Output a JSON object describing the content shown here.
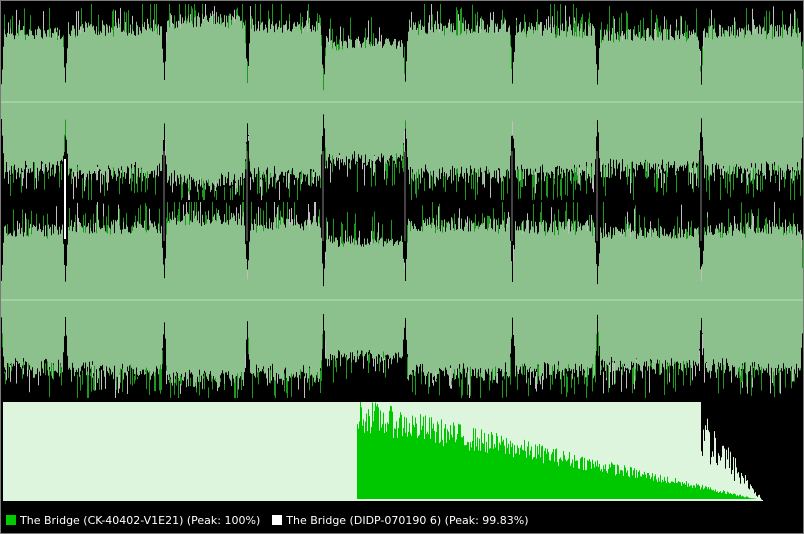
{
  "colors": {
    "background": "#000000",
    "track_a": "#00cc00",
    "track_b": "#ffffff",
    "waveform_fill": "#8cc08c",
    "waveform_spike_a": "#1e9a1e",
    "waveform_spike_b": "#c0c0c0",
    "centerline": "#b8e0b8",
    "spectrum_base": "#dcf5dc",
    "spectrum_peak": "#00c800"
  },
  "legend": {
    "items": [
      {
        "color": "#00cc00",
        "label": "The Bridge (CK-40402-V1E21) (Peak: 100%)"
      },
      {
        "color": "#ffffff",
        "label": "The Bridge (DIDP-070190 6) (Peak: 99.83%)"
      }
    ]
  },
  "waveform": {
    "segment_levels": [
      0.78,
      0.82,
      0.92,
      0.86,
      0.66,
      0.85,
      0.82,
      0.76,
      0.8,
      0.9
    ]
  }
}
